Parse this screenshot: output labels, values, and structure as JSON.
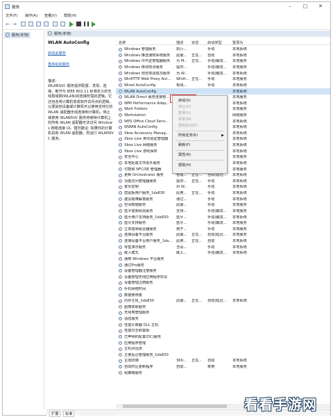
{
  "window": {
    "title": "服务"
  },
  "menu": [
    "文件(F)",
    "操作(A)",
    "查看(V)",
    "帮助(H)"
  ],
  "tree": {
    "item": "服务(本地)"
  },
  "panel": {
    "header": "服务(本地)"
  },
  "detail": {
    "service_name": "WLAN AutoConfig",
    "link_start": "启动此服务",
    "link_restart": "重启动此服务",
    "desc_label": "描述:",
    "desc_text": "WLANSVC 服务提供配置、发现、连接、断开与 IEEE 802.11 标准定义的无线局域网(WLAN)的连接所需的逻辑。它还包含将计算机变成软件访问点的逻辑，以便其他设备或计算机可以使用支持它的 WLAN 适配器无线连接到计算机。停止或禁用 WLANSVC 服务将使得计算机上的所有 WLAN 适配器无法访问 Windows 网络连接 UI。强烈建议: 如果你的计算机具有 WLAN 适配器，则运行 WLANSVC 服务。"
  },
  "columns": [
    "名称",
    "描述",
    "状态",
    "启动类型",
    "登录为"
  ],
  "services": [
    {
      "name": "Windows 管理服务",
      "desc": "执行...",
      "status": "",
      "start": "手动",
      "logon": "本地系统"
    },
    {
      "name": "Windows 推送通知系统服务",
      "desc": "此服...",
      "status": "正在...",
      "start": "自动",
      "logon": "本地系统"
    },
    {
      "name": "Windows 许可证管理器服务",
      "desc": "为 M...",
      "status": "正在...",
      "start": "手动(触发...",
      "logon": "本地服务"
    },
    {
      "name": "Windows 移动热点服务",
      "desc": "提供...",
      "status": "",
      "start": "手动(触发...",
      "logon": "本地服务"
    },
    {
      "name": "Windows 预览体验成员服务",
      "desc": "为 W...",
      "status": "",
      "start": "手动(触发...",
      "logon": "本地系统"
    },
    {
      "name": "WinHTTP Web Proxy Aut...",
      "desc": "WinH...",
      "status": "正在...",
      "start": "手动",
      "logon": "本地服务"
    },
    {
      "name": "Wired AutoConfig",
      "desc": "有线...",
      "status": "",
      "start": "手动",
      "logon": "本地系统"
    },
    {
      "name": "WLAN AutoConfig",
      "desc": "",
      "status": "",
      "start": "",
      "logon": "本地系统"
    },
    {
      "name": "WLAN Direct 服务连接管...",
      "desc": "",
      "status": "",
      "start": "",
      "logon": "本地服务"
    },
    {
      "name": "WMI Performance Adap...",
      "desc": "",
      "status": "",
      "start": "",
      "logon": "本地系统"
    },
    {
      "name": "Work Folders",
      "desc": "",
      "status": "",
      "start": "",
      "logon": "本地服务"
    },
    {
      "name": "Workstation",
      "desc": "",
      "status": "",
      "start": "",
      "logon": "网络服务"
    },
    {
      "name": "WPS Office Cloud Servi...",
      "desc": "",
      "status": "",
      "start": "",
      "logon": "本地系统"
    },
    {
      "name": "WWAN AutoConfig",
      "desc": "",
      "status": "",
      "start": "",
      "logon": "本地系统"
    },
    {
      "name": "Xbox Accessory Manag...",
      "desc": "",
      "status": "",
      "start": "",
      "logon": "本地系统"
    },
    {
      "name": "Xbox Live 身份验证管理器",
      "desc": "",
      "status": "",
      "start": "",
      "logon": "本地系统"
    },
    {
      "name": "Xbox Live 网络服务",
      "desc": "",
      "status": "",
      "start": "",
      "logon": "本地系统"
    },
    {
      "name": "Xbox Live 游戏保存",
      "desc": "",
      "status": "",
      "start": "",
      "logon": "本地系统"
    },
    {
      "name": "安全中心",
      "desc": "",
      "status": "",
      "start": "",
      "logon": "本地服务"
    },
    {
      "name": "本地配置文件助手服务",
      "desc": "此服...",
      "status": "",
      "start": "手动(触发...",
      "logon": "本地系统"
    },
    {
      "name": "付款和 NFC/SE 管理器",
      "desc": "管理...",
      "status": "",
      "start": "手动(触发...",
      "logon": "本地服务"
    },
    {
      "name": "更新 Orchestrator 服务",
      "desc": "管理...",
      "status": "正在...",
      "start": "自动(延迟...",
      "logon": "本地系统"
    },
    {
      "name": "功能访问管理器服务",
      "desc": "提供...",
      "status": "正在...",
      "start": "手动",
      "logon": "本地系统"
    },
    {
      "name": "家长控制",
      "desc": "对 W...",
      "status": "",
      "start": "手动",
      "logon": "本地系统"
    },
    {
      "name": "剪贴板用户服务_1da830",
      "desc": "此用...",
      "status": "正在...",
      "start": "手动",
      "logon": "本地系统"
    },
    {
      "name": "建议疑难解答服务",
      "desc": "通过...",
      "status": "",
      "start": "手动",
      "logon": "本地系统"
    },
    {
      "name": "空间数据服务",
      "desc": "此服...",
      "status": "",
      "start": "手动",
      "logon": "本地服务"
    },
    {
      "name": "蓝牙音频网关服务",
      "desc": "支持...",
      "status": "",
      "start": "手动(触发...",
      "logon": "本地服务"
    },
    {
      "name": "蓝牙用户支持服务_1da830",
      "desc": "蓝牙...",
      "status": "",
      "start": "手动(触发...",
      "logon": "本地系统"
    },
    {
      "name": "蓝牙支持服务",
      "desc": "蓝牙...",
      "status": "",
      "start": "手动(触发...",
      "logon": "本地服务"
    },
    {
      "name": "立体音频组合器服务",
      "desc": "用于...",
      "status": "",
      "start": "手动",
      "logon": "本地服务"
    },
    {
      "name": "连接设备平台服务",
      "desc": "此服...",
      "status": "正在...",
      "start": "自动(延迟...",
      "logon": "本地服务"
    },
    {
      "name": "连接设备平台用户服务_1da...",
      "desc": "此用...",
      "status": "正在...",
      "start": "自动",
      "logon": "本地系统"
    },
    {
      "name": "零售演示服务",
      "desc": "当设...",
      "status": "",
      "start": "手动",
      "logon": "本地系统"
    },
    {
      "name": "嵌入模式",
      "desc": "嵌入...",
      "status": "",
      "start": "手动(触发...",
      "logon": "本地系统"
    },
    {
      "name": "通用 Windows 平台服务",
      "desc": "",
      "status": "",
      "start": "",
      "logon": ""
    },
    {
      "name": "通过Pro服务",
      "desc": "",
      "status": "",
      "start": "",
      "logon": ""
    },
    {
      "name": "设备管理器注册服务",
      "desc": "",
      "status": "",
      "start": "",
      "logon": ""
    },
    {
      "name": "设备管理无线应用程序协议",
      "desc": "",
      "status": "",
      "start": "",
      "logon": ""
    },
    {
      "name": "设备管理注册服务",
      "desc": "",
      "status": "",
      "start": "",
      "logon": ""
    },
    {
      "name": "手机网络时间",
      "desc": "",
      "status": "",
      "start": "",
      "logon": ""
    },
    {
      "name": "数据使用量",
      "desc": "",
      "status": "",
      "start": "",
      "logon": ""
    },
    {
      "name": "同步主机_1da830",
      "desc": "此服...",
      "status": "正在...",
      "start": "自动(延迟...",
      "logon": "本地系统"
    },
    {
      "name": "图像获取服务",
      "desc": "",
      "status": "",
      "start": "",
      "logon": ""
    },
    {
      "name": "无线电管理服务",
      "desc": "",
      "status": "",
      "start": "",
      "logon": ""
    },
    {
      "name": "消息服务",
      "desc": "",
      "status": "",
      "start": "",
      "logon": ""
    },
    {
      "name": "性能计数器 DLL 主机",
      "desc": "",
      "status": "",
      "start": "",
      "logon": ""
    },
    {
      "name": "性能日志和警报",
      "desc": "",
      "status": "",
      "start": "",
      "logon": ""
    },
    {
      "name": "已声明的配置(DC)服务",
      "desc": "",
      "status": "",
      "start": "",
      "logon": ""
    },
    {
      "name": "应用程序管理",
      "desc": "",
      "status": "",
      "start": "",
      "logon": ""
    },
    {
      "name": "主机对话流",
      "desc": "",
      "status": "",
      "start": "",
      "logon": ""
    },
    {
      "name": "主要后台管理服务_1da830",
      "desc": "",
      "status": "",
      "start": "",
      "logon": ""
    },
    {
      "name": "主动防御",
      "desc": "360...",
      "status": "正在...",
      "start": "自动",
      "logon": "本地系统"
    },
    {
      "name": "自动时区更新程序",
      "desc": "自动...",
      "status": "",
      "start": "禁用",
      "logon": "本地服务"
    },
    {
      "name": "组策略服务",
      "desc": "",
      "status": "",
      "start": "",
      "logon": ""
    }
  ],
  "context_menu": {
    "start": "启动(S)",
    "stop": "停止(O)",
    "pause": "暂停(U)",
    "resume": "恢复(M)",
    "restart": "重新启动(E)",
    "all_tasks": "所有任务(K)",
    "refresh": "刷新(F)",
    "properties": "属性(R)",
    "help": "帮助(H)"
  },
  "tabs": [
    "扩展",
    "标准"
  ],
  "watermark": "看看手游网",
  "colors": {
    "selection": "#cfe3f7",
    "highlight_box": "#e0201b",
    "link": "#1f5fb4"
  }
}
